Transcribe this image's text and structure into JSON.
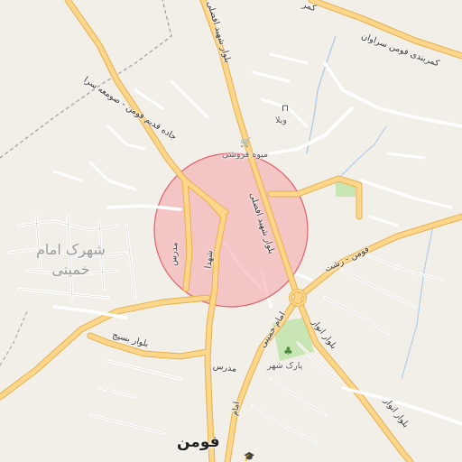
{
  "map": {
    "city_label": "فومن",
    "district_label_line1": "شهرک امام",
    "district_label_line2": "خمینی",
    "roads": {
      "fuman_saravan": "کمربندی فومن سراوان",
      "shahid_afzali": "بلوار شهید افضلی",
      "shahid_afzali_upper": "بلوار شهید افضلی",
      "old_fuman_road": "جاده قدیم فومن - صومعه سرا",
      "modarres": "مدرس",
      "modarres_south": "مدرس",
      "shoara": "شهدا",
      "emam_khomeini": "امام خمینی",
      "anvar": "بلوار انوار",
      "anvar_south": "بلوار انوار",
      "basij": "بلوار بسیج",
      "fuman_rasht": "فومن - رشت",
      "north_corner": "کمر"
    },
    "pois": {
      "fruit_shop": "میوه فروشی",
      "villa": "ویلا",
      "park": "پارک شهر"
    },
    "icons": {
      "fruit_shop": "shop-icon",
      "villa": "lodging-icon",
      "park": "tree-icon",
      "school": "school-icon"
    },
    "colors": {
      "background": "#f2efe9",
      "major_road": "#fcd68b",
      "major_road_casing": "#e8b04a",
      "minor_road": "#ffffff",
      "street_casing": "#cfcac2",
      "highlight_fill": "#f5a3a8",
      "highlight_stroke": "#e0606a",
      "park": "#c8e6b3",
      "water": "#a8c8e8",
      "boundary": "#9e9e9e"
    }
  }
}
